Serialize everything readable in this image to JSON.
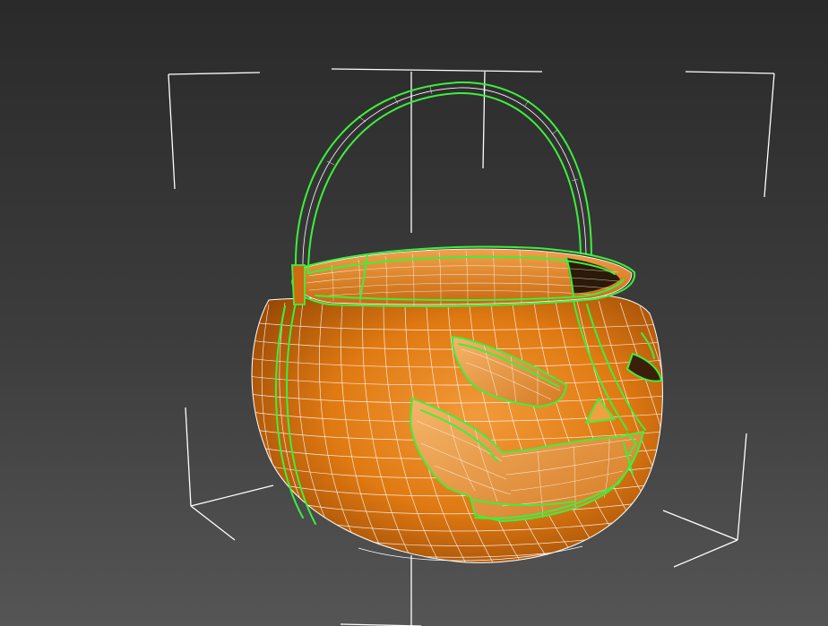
{
  "viewport": {
    "background_top": "#2a2a2a",
    "background_bottom": "#555555",
    "selection_color": "#3cf03c",
    "wire_color": "#ffffff",
    "object_color": "#e07a12"
  },
  "object": {
    "name": "pumpkin-basket",
    "state": "selected"
  }
}
